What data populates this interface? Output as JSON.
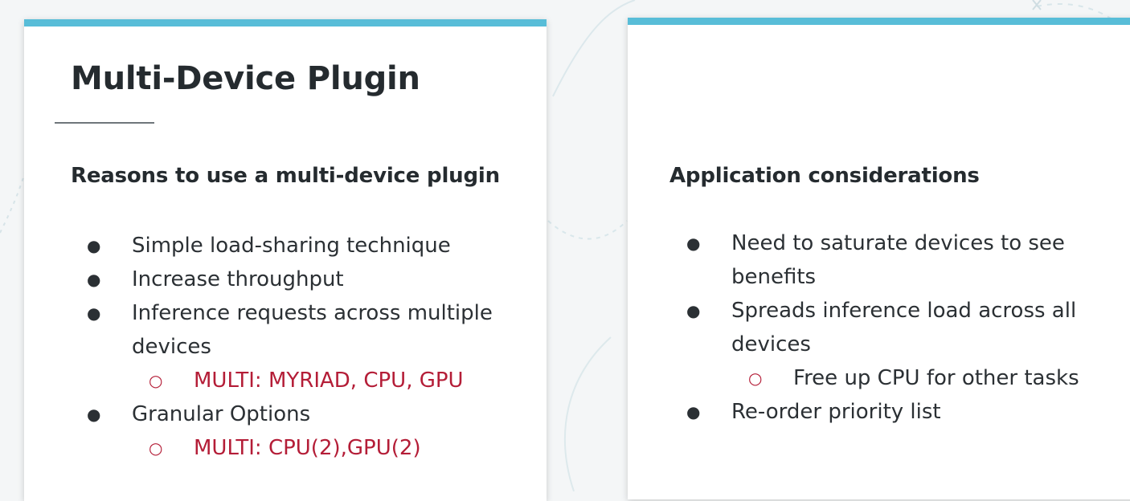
{
  "slides": {
    "left": {
      "title": "Multi-Device Plugin",
      "heading": "Reasons to use a multi-device plugin",
      "items": [
        {
          "label": "Simple load-sharing technique"
        },
        {
          "label": "Increase throughput"
        },
        {
          "label": "Inference requests across multiple devices"
        },
        {
          "label": "MULTI: MYRIAD, CPU, GPU"
        },
        {
          "label": "Granular Options"
        },
        {
          "label": "MULTI: CPU(2),GPU(2)"
        }
      ]
    },
    "right": {
      "heading": "Application considerations",
      "items": [
        {
          "label": "Need to saturate devices to see benefits"
        },
        {
          "label": "Spreads inference load across all devices"
        },
        {
          "label": "Free up CPU for other tasks"
        },
        {
          "label": "Re-order priority list"
        }
      ]
    }
  },
  "colors": {
    "accent_blue": "#58bdd8",
    "accent_red": "#b41d37",
    "text_dark": "#252b2f"
  }
}
